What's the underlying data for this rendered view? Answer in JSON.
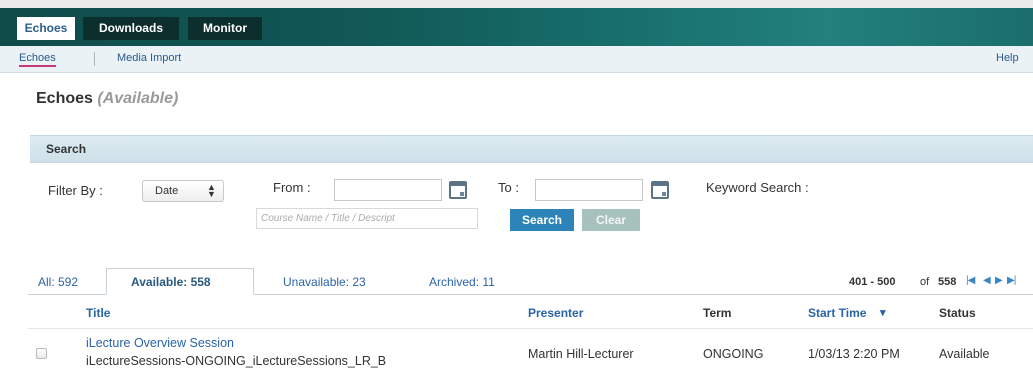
{
  "main_tabs": [
    {
      "label": "Echoes",
      "active": true
    },
    {
      "label": "Downloads",
      "active": false
    },
    {
      "label": "Monitor",
      "active": false
    }
  ],
  "sub_nav": {
    "items": [
      {
        "label": "Echoes",
        "active": true
      },
      {
        "label": "Media Import",
        "active": false
      }
    ],
    "help": "Help"
  },
  "page": {
    "title": "Echoes",
    "subtitle": "(Available)"
  },
  "search": {
    "header": "Search",
    "filter_label": "Filter By :",
    "filter_value": "Date",
    "from_label": "From :",
    "from_value": "",
    "to_label": "To :",
    "to_value": "",
    "keyword_label": "Keyword Search :",
    "keyword_placeholder": "Course Name / Title / Descript",
    "search_button": "Search",
    "clear_button": "Clear"
  },
  "status_tabs": [
    {
      "label": "All: 592",
      "active": false
    },
    {
      "label": "Available: 558",
      "active": true
    },
    {
      "label": "Unavailable: 23",
      "active": false
    },
    {
      "label": "Archived: 11",
      "active": false
    }
  ],
  "pager": {
    "range": "401 - 500",
    "of": "of",
    "total": "558",
    "icons": [
      "first-page-icon",
      "prev-page-icon",
      "next-page-icon",
      "last-page-icon"
    ]
  },
  "table": {
    "columns": [
      "Title",
      "Presenter",
      "Term",
      "Start Time",
      "Status"
    ],
    "sort_indicator": "▾",
    "rows": [
      {
        "title": "iLecture Overview Session",
        "section": "iLectureSessions-ONGOING_iLectureSessions_LR_B",
        "presenter": "Martin Hill-Lecturer",
        "term": "ONGOING",
        "start_time": "1/03/13 2:20 PM",
        "status": "Available"
      }
    ]
  },
  "colors": {
    "header_bar": "#115856",
    "link_blue": "#2a64a6",
    "search_button": "#2d84b8",
    "clear_button": "#a7c2bd",
    "active_underline": "#c33b7c"
  }
}
